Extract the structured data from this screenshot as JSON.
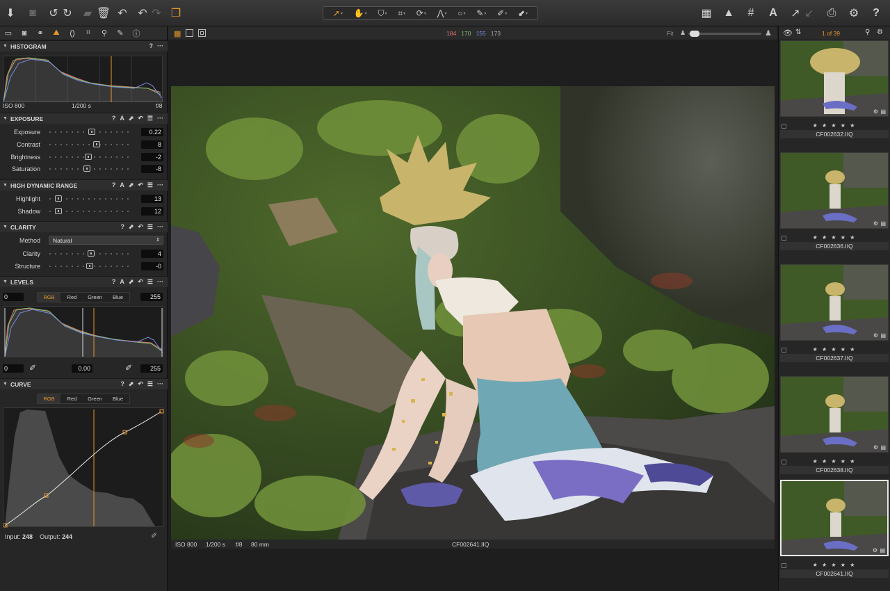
{
  "toolbar": {
    "left_icons": [
      "import-icon",
      "camera-icon",
      "rotate-left-icon",
      "rotate-right-icon",
      "folder-icon",
      "trash-icon",
      "undo-all-icon",
      "undo-icon",
      "redo-icon",
      "variants-icon"
    ],
    "right_icons": [
      "grid-view-icon",
      "warning-icon",
      "grid-overlay-icon",
      "text-icon",
      "copy-adjustments-icon",
      "apply-adjustments-icon",
      "print-icon",
      "settings-icon",
      "help-icon"
    ],
    "text_icon_label": "A",
    "help_label": "?"
  },
  "left_tabs": [
    "library-tab",
    "capture-tab",
    "color-tab",
    "exposure-tab",
    "lens-tab",
    "crop-tab",
    "focus-tab",
    "details-tab",
    "metadata-tab"
  ],
  "histogram": {
    "title": "HISTOGRAM",
    "iso": "ISO 800",
    "shutter": "1/200 s",
    "aperture": "f/8"
  },
  "exposure": {
    "title": "EXPOSURE",
    "sliders": [
      {
        "label": "Exposure",
        "value": "0.22"
      },
      {
        "label": "Contrast",
        "value": "8"
      },
      {
        "label": "Brightness",
        "value": "-2"
      },
      {
        "label": "Saturation",
        "value": "-8"
      }
    ]
  },
  "hdr": {
    "title": "HIGH DYNAMIC RANGE",
    "sliders": [
      {
        "label": "Highlight",
        "value": "13"
      },
      {
        "label": "Shadow",
        "value": "12"
      }
    ]
  },
  "clarity": {
    "title": "CLARITY",
    "method_label": "Method",
    "method_value": "Natural",
    "sliders": [
      {
        "label": "Clarity",
        "value": "4"
      },
      {
        "label": "Structure",
        "value": "-0"
      }
    ]
  },
  "levels": {
    "title": "LEVELS",
    "channels": [
      "RGB",
      "Red",
      "Green",
      "Blue"
    ],
    "active_channel": "RGB",
    "input_low": "0",
    "input_high": "255",
    "output_low": "0",
    "midpoint": "0.00",
    "output_high": "255"
  },
  "curve": {
    "title": "CURVE",
    "channels": [
      "RGB",
      "Red",
      "Green",
      "Blue"
    ],
    "input_label": "Input:",
    "input_value": "248",
    "output_label": "Output:",
    "output_value": "244"
  },
  "section_actions": {
    "help": "?",
    "more": "···",
    "auto": "A"
  },
  "viewer": {
    "rgb_readout": {
      "r": "184",
      "g": "170",
      "b": "155",
      "l": "173"
    },
    "fit_label": "Fit",
    "caption": {
      "iso": "ISO 800",
      "shutter": "1/200 s",
      "aperture": "f/8",
      "focal": "80 mm",
      "filename": "CF002641.IIQ"
    }
  },
  "browser": {
    "counter": "1 of 39",
    "stars": "★ ★ ★ ★ ★",
    "thumbnails": [
      {
        "filename": "CF002632.IIQ"
      },
      {
        "filename": "CF002636.IIQ"
      },
      {
        "filename": "CF002637.IIQ"
      },
      {
        "filename": "CF002638.IIQ"
      },
      {
        "filename": "CF002641.IIQ"
      }
    ]
  },
  "colors": {
    "accent": "#e8962b",
    "red_channel": "#e07070",
    "green_channel": "#7fc26a",
    "blue_channel": "#7a8ee0",
    "panel_bg": "#262626"
  }
}
